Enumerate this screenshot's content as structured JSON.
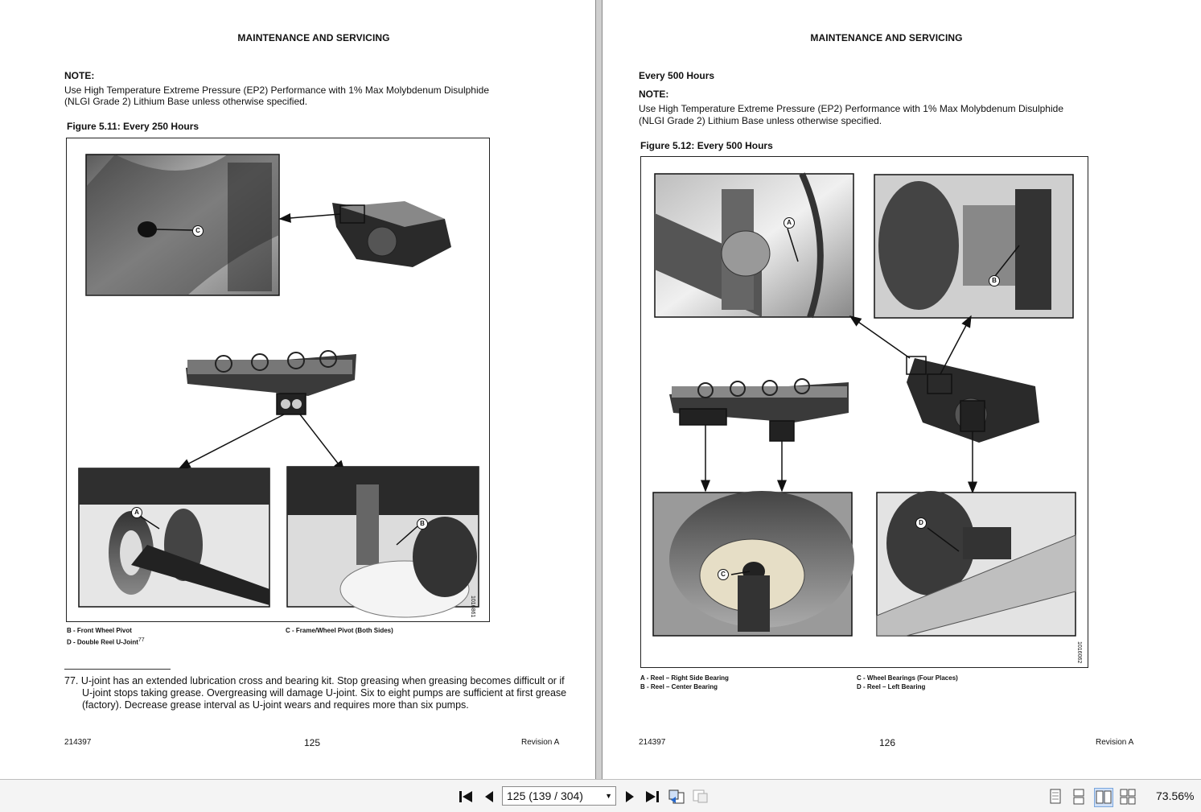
{
  "left_page": {
    "header": "MAINTENANCE AND SERVICING",
    "note_label": "NOTE:",
    "note_line1": "Use High Temperature Extreme Pressure (EP2) Performance with 1% Max Molybdenum Disulphide",
    "note_line2": "(NLGI Grade 2) Lithium Base unless otherwise specified.",
    "figure_caption": "Figure 5.11: Every 250 Hours",
    "figure_id": "1016861",
    "callouts": [
      "C",
      "A",
      "B"
    ],
    "legend": {
      "b": "B - Front Wheel Pivot",
      "c": "C - Frame/Wheel Pivot (Both Sides)",
      "d": "D - Double Reel U-Joint",
      "d_sup": "77"
    },
    "footnote_line1": "77. U-joint has an extended lubrication cross and bearing kit. Stop greasing when greasing becomes difficult or if",
    "footnote_line2": "U-joint stops taking grease. Overgreasing will damage U-joint. Six to eight pumps are sufficient at first grease",
    "footnote_line3": "(factory). Decrease grease interval as U-joint wears and requires more than six pumps.",
    "doc_number": "214397",
    "page_number": "125",
    "revision": "Revision  A"
  },
  "right_page": {
    "header": "MAINTENANCE AND SERVICING",
    "section_title": "Every 500 Hours",
    "note_label": "NOTE:",
    "note_line1": "Use High Temperature Extreme Pressure (EP2) Performance with 1% Max Molybdenum Disulphide",
    "note_line2": "(NLGI Grade 2) Lithium Base unless otherwise specified.",
    "figure_caption": "Figure 5.12: Every 500 Hours",
    "figure_id": "1016062",
    "callouts": [
      "A",
      "B",
      "C",
      "D"
    ],
    "legend": {
      "a": "A - Reel – Right Side Bearing",
      "b": "B - Reel – Center Bearing",
      "c": "C - Wheel Bearings (Four Places)",
      "d": "D - Reel – Left Bearing"
    },
    "doc_number": "214397",
    "page_number": "126",
    "revision": "Revision  A"
  },
  "toolbar": {
    "page_value": "125 (139 / 304)",
    "zoom": "73.56%",
    "icons": [
      "first-page-icon",
      "prev-page-icon",
      "next-page-icon",
      "last-page-icon",
      "go-back-icon",
      "go-forward-icon",
      "single-page-icon",
      "continuous-icon",
      "two-page-icon",
      "two-page-continuous-icon"
    ]
  }
}
